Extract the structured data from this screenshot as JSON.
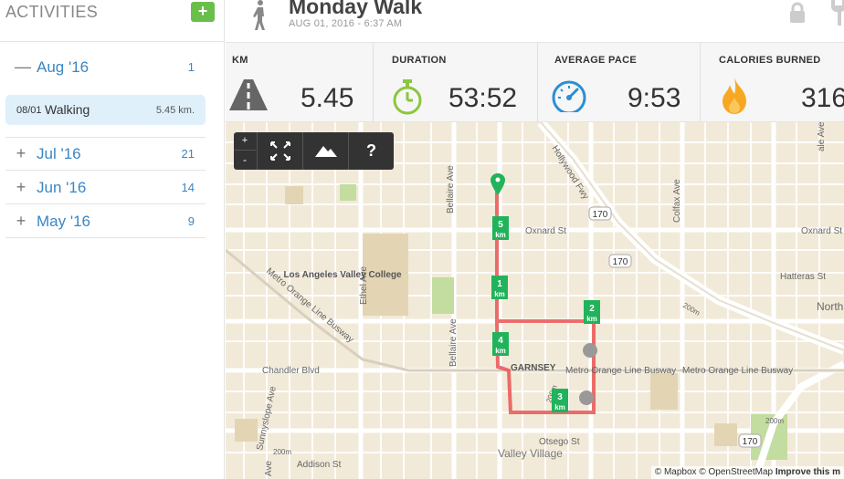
{
  "sidebar": {
    "title": "ACTIVITIES",
    "add_label": "+",
    "months": [
      {
        "sign": "—",
        "label": "Aug '16",
        "count": "1"
      },
      {
        "sign": "+",
        "label": "Jul '16",
        "count": "21"
      },
      {
        "sign": "+",
        "label": "Jun '16",
        "count": "14"
      },
      {
        "sign": "+",
        "label": "May '16",
        "count": "9"
      }
    ],
    "activity": {
      "date": "08/01",
      "type": "Walking",
      "distance": "5.45 km."
    }
  },
  "header": {
    "title": "Monday Walk",
    "date": "AUG 01, 2016  -  6:37 AM"
  },
  "stats": [
    {
      "label": "KM",
      "value": "5.45",
      "icon": "road-icon"
    },
    {
      "label": "DURATION",
      "value": "53:52",
      "icon": "stopwatch-icon"
    },
    {
      "label": "AVERAGE PACE",
      "value": "9:53",
      "icon": "speedometer-icon"
    },
    {
      "label": "CALORIES BURNED",
      "value": "316",
      "icon": "flame-icon"
    }
  ],
  "map": {
    "controls": {
      "zoom_in": "+",
      "zoom_out": "-",
      "help": "?"
    },
    "labels": {
      "bellaire": "Bellaire Ave",
      "hollywood": "Hollywood Fwy",
      "colfax": "Colfax Ave",
      "oxnard1": "Oxnard St",
      "oxnard2": "Oxnard St",
      "hatteras": "Hatteras St",
      "north": "North",
      "lavc": "Los Angeles Valley College",
      "ethel": "Ethel Ave",
      "metro": "Metro Orange Line Busway",
      "metro2": "Metro Orange Line Busway",
      "metro3": "Metro Orange Line Busway",
      "chandler": "Chandler Blvd",
      "garnsey": "GARNSEY",
      "bellaire2": "Bellaire Ave",
      "sunnyslope": "Sunnyslope Ave",
      "otsego": "Otsego St",
      "valley_village": "Valley Village",
      "addison": "Addison St",
      "hwy1": "170",
      "hwy2": "170",
      "hwy3": "170",
      "ave": "Ave",
      "s200m1": "200m",
      "s200m2": "200m",
      "s200m3": "200m",
      "s200m4": "200m",
      "ale": "ale Ave"
    },
    "km_markers": [
      {
        "num": "5",
        "unit": "km"
      },
      {
        "num": "1",
        "unit": "km"
      },
      {
        "num": "2",
        "unit": "km"
      },
      {
        "num": "4",
        "unit": "km"
      },
      {
        "num": "3",
        "unit": "km"
      }
    ],
    "attribution": {
      "text": "© Mapbox © OpenStreetMap ",
      "link": "Improve this m"
    }
  },
  "colors": {
    "accent_blue": "#3a86c4",
    "add_green": "#6abf4b",
    "route_red": "#e85555",
    "marker_green": "#21b35c",
    "stopwatch_green": "#8cc63f",
    "pace_blue": "#2a8fd4",
    "flame_orange": "#f7a823"
  }
}
